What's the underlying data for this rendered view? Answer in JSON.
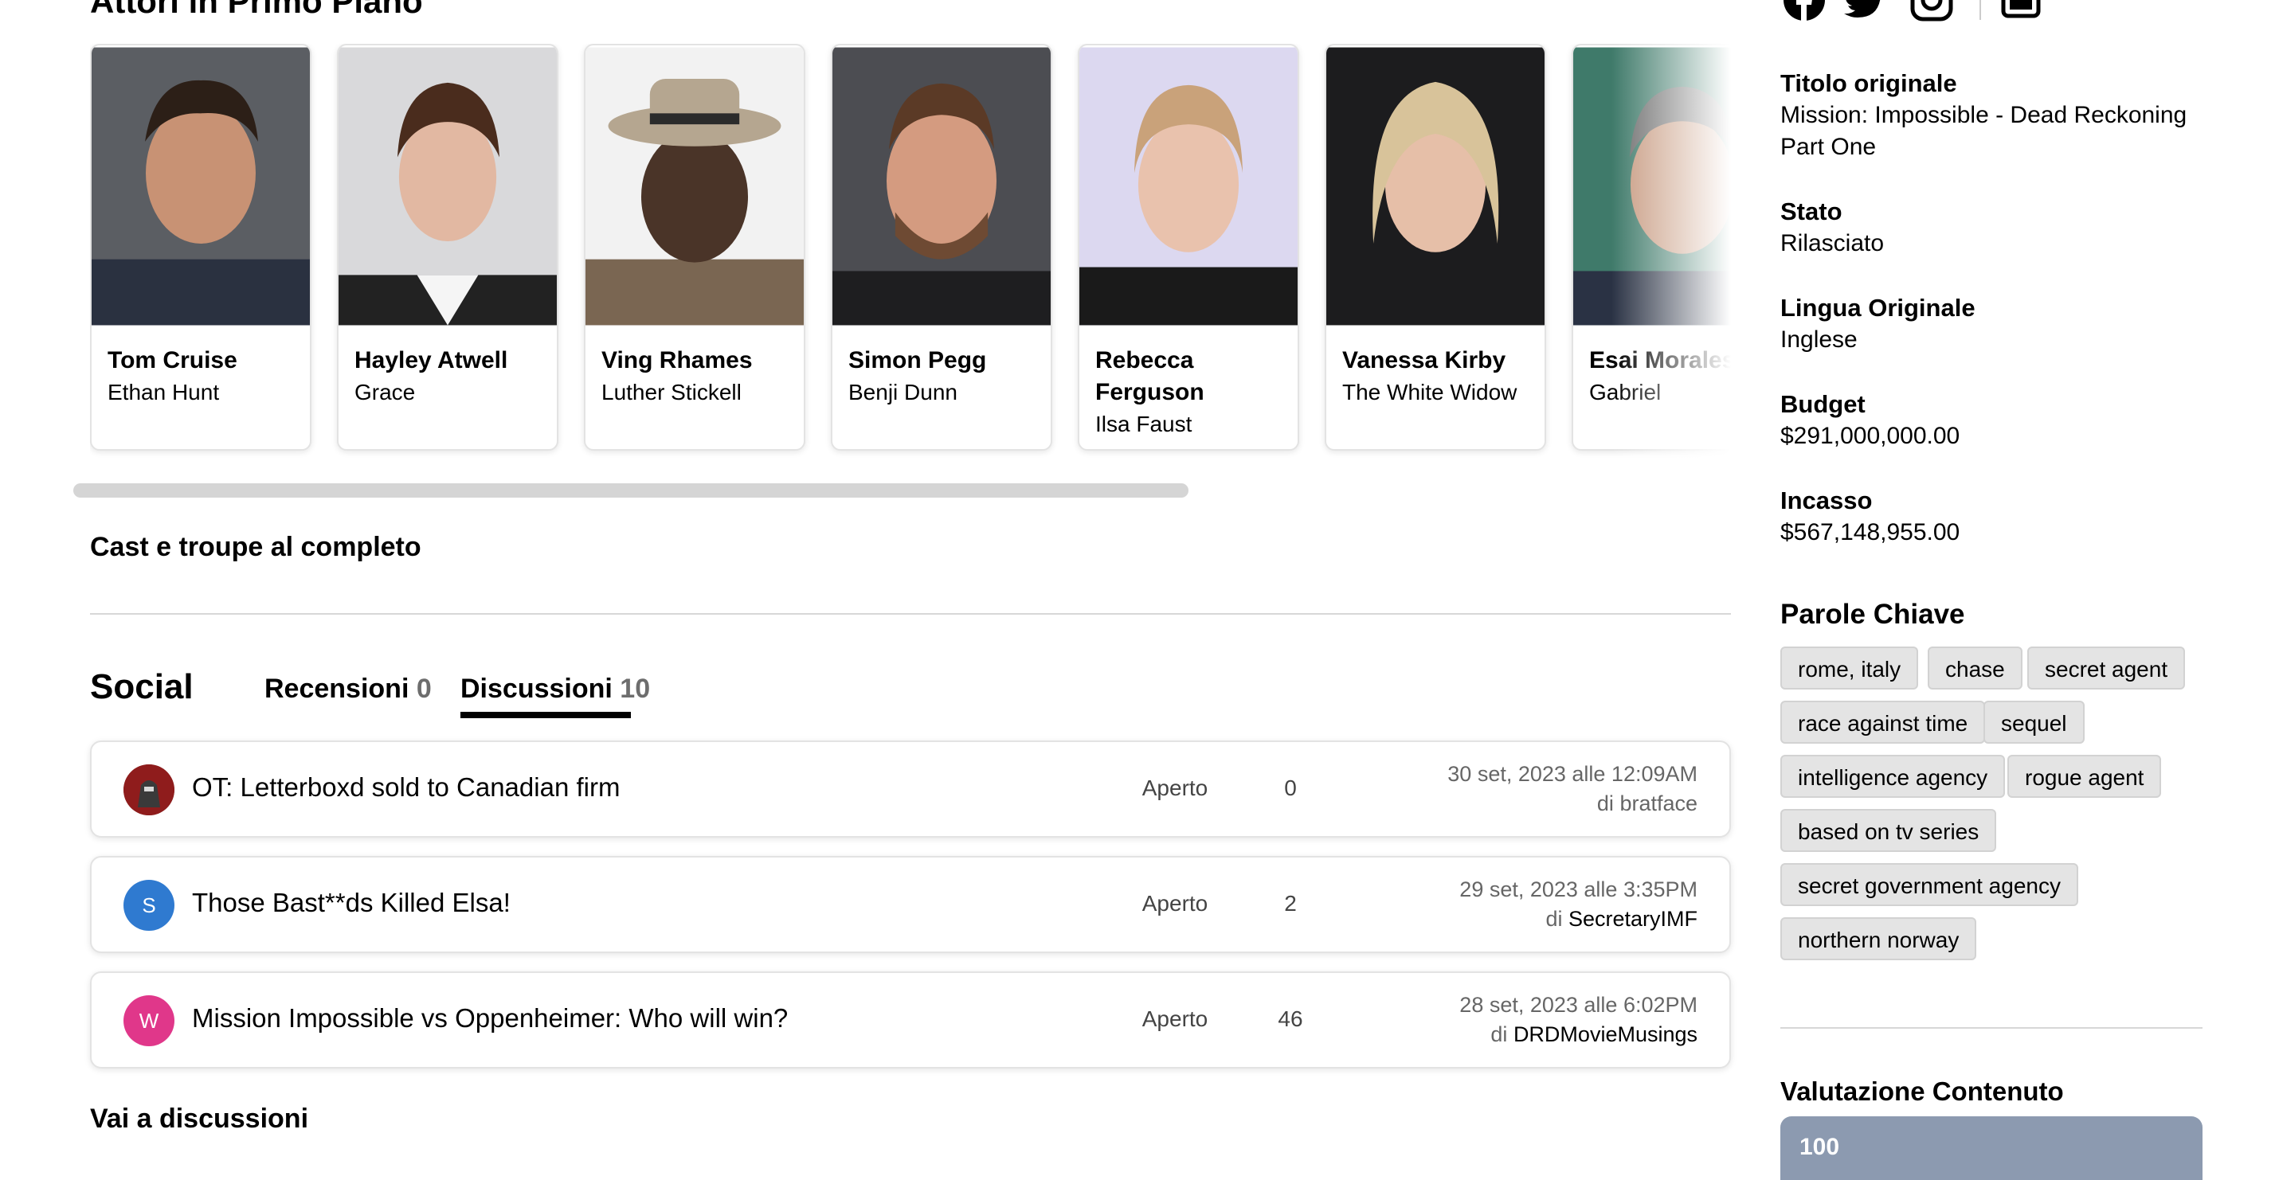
{
  "cast_section": {
    "title": "Attori in Primo Piano",
    "members": [
      {
        "name": "Tom Cruise",
        "character": "Ethan Hunt"
      },
      {
        "name": "Hayley Atwell",
        "character": "Grace"
      },
      {
        "name": "Ving Rhames",
        "character": "Luther Stickell"
      },
      {
        "name": "Simon Pegg",
        "character": "Benji Dunn"
      },
      {
        "name": "Rebecca Ferguson",
        "character": "Ilsa Faust"
      },
      {
        "name": "Vanessa Kirby",
        "character": "The White Widow"
      },
      {
        "name": "Esai Morales",
        "character": "Gabriel"
      }
    ],
    "full_cast_link": "Cast e troupe al completo"
  },
  "social": {
    "title": "Social",
    "tabs": [
      {
        "label": "Recensioni",
        "count": "0"
      },
      {
        "label": "Discussioni",
        "count": "10",
        "active": true
      }
    ],
    "discussions": [
      {
        "title": "OT: Letterboxd sold to Canadian firm",
        "status": "Aperto",
        "replies": "0",
        "date": "30 set, 2023 alle 12:09AM",
        "by_prefix": "di",
        "author": "bratface",
        "avatar_letter": "",
        "avatar_color": "#7a1a1a"
      },
      {
        "title": "Those Bast**ds Killed Elsa!",
        "status": "Aperto",
        "replies": "2",
        "date": "29 set, 2023 alle 3:35PM",
        "by_prefix": "di",
        "author": "SecretaryIMF",
        "avatar_letter": "S",
        "avatar_color": "#2f7ad0"
      },
      {
        "title": "Mission Impossible vs Oppenheimer: Who will win?",
        "status": "Aperto",
        "replies": "46",
        "date": "28 set, 2023 alle 6:02PM",
        "by_prefix": "di",
        "author": "DRDMovieMusings",
        "avatar_letter": "W",
        "avatar_color": "#e0378a"
      }
    ],
    "goto_link": "Vai a discussioni"
  },
  "sidebar": {
    "social_icons": [
      "facebook-icon",
      "twitter-icon",
      "instagram-icon",
      "link-icon"
    ],
    "facts": [
      {
        "label": "Titolo originale",
        "value": "Mission: Impossible - Dead Reckoning Part One"
      },
      {
        "label": "Stato",
        "value": "Rilasciato"
      },
      {
        "label": "Lingua Originale",
        "value": "Inglese"
      },
      {
        "label": "Budget",
        "value": "$291,000,000.00"
      },
      {
        "label": "Incasso",
        "value": "$567,148,955.00"
      }
    ],
    "keywords_title": "Parole Chiave",
    "keywords": [
      "rome, italy",
      "chase",
      "secret agent",
      "race against time",
      "sequel",
      "intelligence agency",
      "rogue agent",
      "based on tv series",
      "secret government agency",
      "northern norway"
    ],
    "rating_title": "Valutazione Contenuto",
    "rating_score": "100"
  }
}
